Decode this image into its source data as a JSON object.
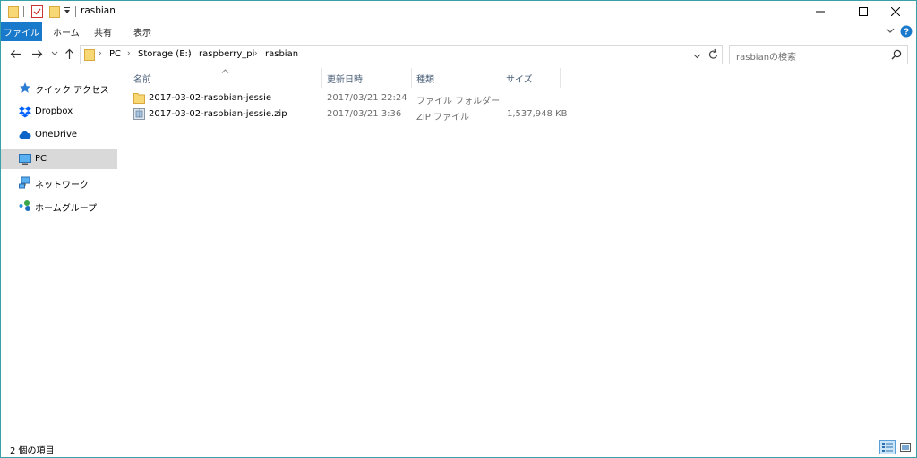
{
  "window": {
    "title": "rasbian",
    "min_icon": "minimize-icon",
    "max_icon": "maximize-icon",
    "close_icon": "close-icon"
  },
  "ribbon": {
    "tabs": [
      {
        "label": "ファイル"
      },
      {
        "label": "ホーム"
      },
      {
        "label": "共有"
      },
      {
        "label": "表示"
      }
    ]
  },
  "address": {
    "crumbs": [
      "PC",
      "Storage (E:)",
      "raspberry_pi",
      "rasbian"
    ]
  },
  "search": {
    "placeholder": "rasbianの検索"
  },
  "nav": {
    "items": [
      {
        "label": "クイック アクセス",
        "icon": "star-icon"
      },
      {
        "label": "Dropbox",
        "icon": "dropbox-icon"
      },
      {
        "label": "OneDrive",
        "icon": "cloud-icon"
      },
      {
        "label": "PC",
        "icon": "computer-icon"
      },
      {
        "label": "ネットワーク",
        "icon": "network-icon"
      },
      {
        "label": "ホームグループ",
        "icon": "homegroup-icon"
      }
    ],
    "selected_index": 3
  },
  "columns": {
    "name": "名前",
    "date": "更新日時",
    "type": "種類",
    "size": "サイズ"
  },
  "files": [
    {
      "name": "2017-03-02-raspbian-jessie",
      "date": "2017/03/21 22:24",
      "type": "ファイル フォルダー",
      "size": "",
      "icon": "folder-icon"
    },
    {
      "name": "2017-03-02-raspbian-jessie.zip",
      "date": "2017/03/21 3:36",
      "type": "ZIP ファイル",
      "size": "1,537,948 KB",
      "icon": "zip-file-icon"
    }
  ],
  "status": {
    "item_count": "2 個の項目"
  },
  "colors": {
    "accent": "#1979ca",
    "window_border": "#3aa0a8",
    "folder": "#f8d775",
    "selected_nav": "#d9d9d9",
    "column_header": "#4c607a"
  }
}
